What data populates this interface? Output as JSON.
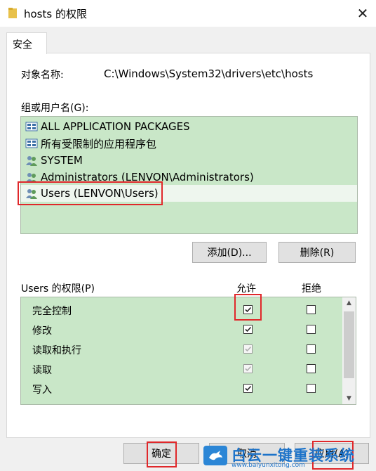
{
  "window": {
    "title": "hosts 的权限",
    "close_icon": "close-icon",
    "folder_icon": "folder-icon"
  },
  "tabs": [
    {
      "label": "安全"
    }
  ],
  "object": {
    "label": "对象名称:",
    "value": "C:\\Windows\\System32\\drivers\\etc\\hosts"
  },
  "groups": {
    "label": "组或用户名(G):",
    "items": [
      {
        "label": "ALL APPLICATION PACKAGES",
        "icon": "package-icon"
      },
      {
        "label": "所有受限制的应用程序包",
        "icon": "package-icon"
      },
      {
        "label": "SYSTEM",
        "icon": "users-icon"
      },
      {
        "label": "Administrators (LENVON\\Administrators)",
        "icon": "users-icon"
      },
      {
        "label": "Users (LENVON\\Users)",
        "icon": "users-icon",
        "selected": true
      }
    ],
    "add_button": "添加(D)...",
    "remove_button": "删除(R)"
  },
  "permissions": {
    "label": "Users 的权限(P)",
    "allow_header": "允许",
    "deny_header": "拒绝",
    "rows": [
      {
        "label": "完全控制",
        "allow": true,
        "allow_disabled": false,
        "deny": false
      },
      {
        "label": "修改",
        "allow": true,
        "allow_disabled": false,
        "deny": false
      },
      {
        "label": "读取和执行",
        "allow": true,
        "allow_disabled": true,
        "deny": false
      },
      {
        "label": "读取",
        "allow": true,
        "allow_disabled": true,
        "deny": false
      },
      {
        "label": "写入",
        "allow": true,
        "allow_disabled": false,
        "deny": false
      }
    ]
  },
  "footer": {
    "ok_button": "确定",
    "cancel_button": "取消",
    "apply_button": "应用(A)"
  },
  "watermark": {
    "text": "白云一键重装系统",
    "url": "www.baiyunxitong.com"
  },
  "colors": {
    "list_bg": "#c9e7c8",
    "highlight": "#e0282b",
    "watermark": "#1d73c9"
  }
}
